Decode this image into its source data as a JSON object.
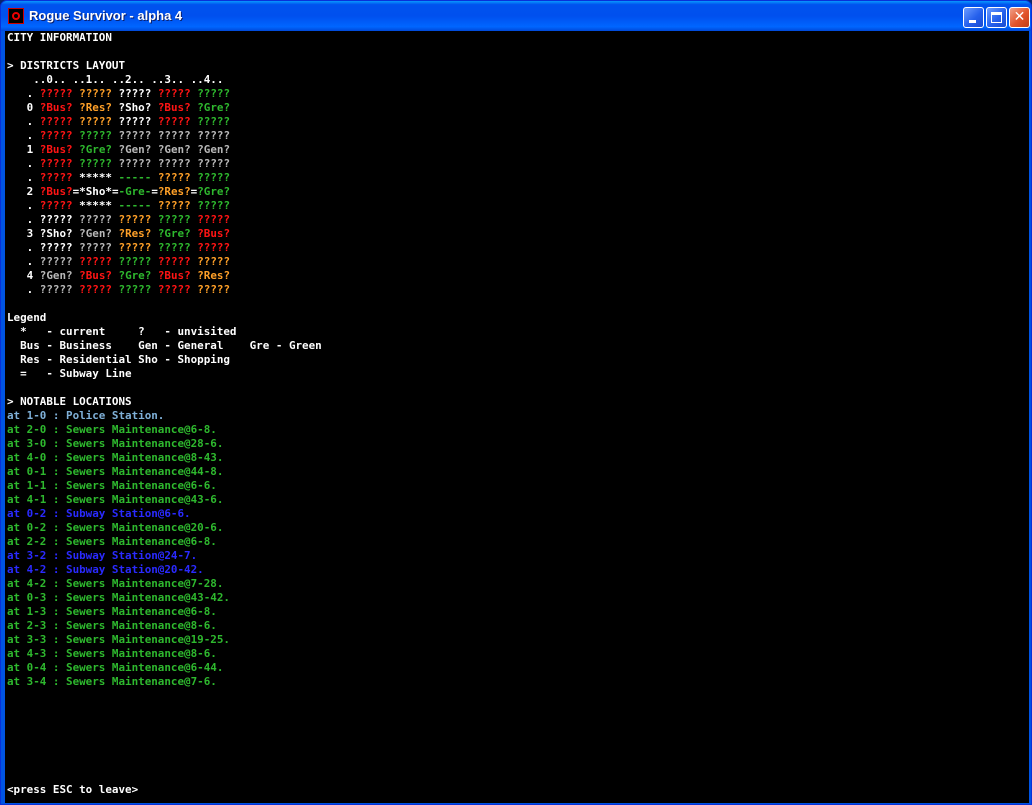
{
  "window": {
    "title": "Rogue Survivor - alpha 4",
    "icon": "rogue-survivor-app-icon"
  },
  "screen": {
    "header": "CITY INFORMATION",
    "districts_heading": "> DISTRICTS LAYOUT",
    "grid_header": "    ..0.. ..1.. ..2.. ..3.. ..4..",
    "colors": {
      "w": "#ffffff",
      "r": "#ff1414",
      "o": "#ffa028",
      "g": "#2eb82e",
      "s": "#b8b8b8",
      "b": "#2a2aff",
      "l": "#7fb0d8"
    },
    "grid_rows": [
      [
        [
          "   . ",
          "w"
        ],
        [
          "?????",
          "r"
        ],
        [
          " ",
          "w"
        ],
        [
          "?????",
          "o"
        ],
        [
          " ",
          "w"
        ],
        [
          "?????",
          "w"
        ],
        [
          " ",
          "w"
        ],
        [
          "?????",
          "r"
        ],
        [
          " ",
          "w"
        ],
        [
          "?????",
          "g"
        ]
      ],
      [
        [
          "   0 ",
          "w"
        ],
        [
          "?Bus?",
          "r"
        ],
        [
          " ",
          "w"
        ],
        [
          "?Res?",
          "o"
        ],
        [
          " ",
          "w"
        ],
        [
          "?Sho?",
          "w"
        ],
        [
          " ",
          "w"
        ],
        [
          "?Bus?",
          "r"
        ],
        [
          " ",
          "w"
        ],
        [
          "?Gre?",
          "g"
        ]
      ],
      [
        [
          "   . ",
          "w"
        ],
        [
          "?????",
          "r"
        ],
        [
          " ",
          "w"
        ],
        [
          "?????",
          "o"
        ],
        [
          " ",
          "w"
        ],
        [
          "?????",
          "w"
        ],
        [
          " ",
          "w"
        ],
        [
          "?????",
          "r"
        ],
        [
          " ",
          "w"
        ],
        [
          "?????",
          "g"
        ]
      ],
      [
        [
          "   . ",
          "w"
        ],
        [
          "?????",
          "r"
        ],
        [
          " ",
          "w"
        ],
        [
          "?????",
          "g"
        ],
        [
          " ",
          "w"
        ],
        [
          "?????",
          "s"
        ],
        [
          " ",
          "w"
        ],
        [
          "?????",
          "s"
        ],
        [
          " ",
          "w"
        ],
        [
          "?????",
          "s"
        ]
      ],
      [
        [
          "   1 ",
          "w"
        ],
        [
          "?Bus?",
          "r"
        ],
        [
          " ",
          "w"
        ],
        [
          "?Gre?",
          "g"
        ],
        [
          " ",
          "w"
        ],
        [
          "?Gen?",
          "s"
        ],
        [
          " ",
          "w"
        ],
        [
          "?Gen?",
          "s"
        ],
        [
          " ",
          "w"
        ],
        [
          "?Gen?",
          "s"
        ]
      ],
      [
        [
          "   . ",
          "w"
        ],
        [
          "?????",
          "r"
        ],
        [
          " ",
          "w"
        ],
        [
          "?????",
          "g"
        ],
        [
          " ",
          "w"
        ],
        [
          "?????",
          "s"
        ],
        [
          " ",
          "w"
        ],
        [
          "?????",
          "s"
        ],
        [
          " ",
          "w"
        ],
        [
          "?????",
          "s"
        ]
      ],
      [
        [
          "   . ",
          "w"
        ],
        [
          "?????",
          "r"
        ],
        [
          " ",
          "w"
        ],
        [
          "*****",
          "w"
        ],
        [
          " ",
          "w"
        ],
        [
          "-----",
          "g"
        ],
        [
          " ",
          "w"
        ],
        [
          "?????",
          "o"
        ],
        [
          " ",
          "w"
        ],
        [
          "?????",
          "g"
        ]
      ],
      [
        [
          "   2 ",
          "w"
        ],
        [
          "?Bus?",
          "r"
        ],
        [
          "=",
          "w"
        ],
        [
          "*Sho*",
          "w"
        ],
        [
          "=",
          "w"
        ],
        [
          "-Gre-",
          "g"
        ],
        [
          "=",
          "w"
        ],
        [
          "?Res?",
          "o"
        ],
        [
          "=",
          "w"
        ],
        [
          "?Gre?",
          "g"
        ]
      ],
      [
        [
          "   . ",
          "w"
        ],
        [
          "?????",
          "r"
        ],
        [
          " ",
          "w"
        ],
        [
          "*****",
          "w"
        ],
        [
          " ",
          "w"
        ],
        [
          "-----",
          "g"
        ],
        [
          " ",
          "w"
        ],
        [
          "?????",
          "o"
        ],
        [
          " ",
          "w"
        ],
        [
          "?????",
          "g"
        ]
      ],
      [
        [
          "   . ",
          "w"
        ],
        [
          "?????",
          "w"
        ],
        [
          " ",
          "w"
        ],
        [
          "?????",
          "s"
        ],
        [
          " ",
          "w"
        ],
        [
          "?????",
          "o"
        ],
        [
          " ",
          "w"
        ],
        [
          "?????",
          "g"
        ],
        [
          " ",
          "w"
        ],
        [
          "?????",
          "r"
        ]
      ],
      [
        [
          "   3 ",
          "w"
        ],
        [
          "?Sho?",
          "w"
        ],
        [
          " ",
          "w"
        ],
        [
          "?Gen?",
          "s"
        ],
        [
          " ",
          "w"
        ],
        [
          "?Res?",
          "o"
        ],
        [
          " ",
          "w"
        ],
        [
          "?Gre?",
          "g"
        ],
        [
          " ",
          "w"
        ],
        [
          "?Bus?",
          "r"
        ]
      ],
      [
        [
          "   . ",
          "w"
        ],
        [
          "?????",
          "w"
        ],
        [
          " ",
          "w"
        ],
        [
          "?????",
          "s"
        ],
        [
          " ",
          "w"
        ],
        [
          "?????",
          "o"
        ],
        [
          " ",
          "w"
        ],
        [
          "?????",
          "g"
        ],
        [
          " ",
          "w"
        ],
        [
          "?????",
          "r"
        ]
      ],
      [
        [
          "   . ",
          "w"
        ],
        [
          "?????",
          "s"
        ],
        [
          " ",
          "w"
        ],
        [
          "?????",
          "r"
        ],
        [
          " ",
          "w"
        ],
        [
          "?????",
          "g"
        ],
        [
          " ",
          "w"
        ],
        [
          "?????",
          "r"
        ],
        [
          " ",
          "w"
        ],
        [
          "?????",
          "o"
        ]
      ],
      [
        [
          "   4 ",
          "w"
        ],
        [
          "?Gen?",
          "s"
        ],
        [
          " ",
          "w"
        ],
        [
          "?Bus?",
          "r"
        ],
        [
          " ",
          "w"
        ],
        [
          "?Gre?",
          "g"
        ],
        [
          " ",
          "w"
        ],
        [
          "?Bus?",
          "r"
        ],
        [
          " ",
          "w"
        ],
        [
          "?Res?",
          "o"
        ]
      ],
      [
        [
          "   . ",
          "w"
        ],
        [
          "?????",
          "s"
        ],
        [
          " ",
          "w"
        ],
        [
          "?????",
          "r"
        ],
        [
          " ",
          "w"
        ],
        [
          "?????",
          "g"
        ],
        [
          " ",
          "w"
        ],
        [
          "?????",
          "r"
        ],
        [
          " ",
          "w"
        ],
        [
          "?????",
          "o"
        ]
      ]
    ],
    "legend_heading": "Legend",
    "legend_lines": [
      "  *   - current     ?   - unvisited",
      "  Bus - Business    Gen - General    Gre - Green",
      "  Res - Residential Sho - Shopping",
      "  =   - Subway Line"
    ],
    "notable_heading": "> NOTABLE LOCATIONS",
    "notable_locations": [
      [
        "at 1-0 : Police Station.",
        "l"
      ],
      [
        "at 2-0 : Sewers Maintenance@6-8.",
        "g"
      ],
      [
        "at 3-0 : Sewers Maintenance@28-6.",
        "g"
      ],
      [
        "at 4-0 : Sewers Maintenance@8-43.",
        "g"
      ],
      [
        "at 0-1 : Sewers Maintenance@44-8.",
        "g"
      ],
      [
        "at 1-1 : Sewers Maintenance@6-6.",
        "g"
      ],
      [
        "at 4-1 : Sewers Maintenance@43-6.",
        "g"
      ],
      [
        "at 0-2 : Subway Station@6-6.",
        "b"
      ],
      [
        "at 0-2 : Sewers Maintenance@20-6.",
        "g"
      ],
      [
        "at 2-2 : Sewers Maintenance@6-8.",
        "g"
      ],
      [
        "at 3-2 : Subway Station@24-7.",
        "b"
      ],
      [
        "at 4-2 : Subway Station@20-42.",
        "b"
      ],
      [
        "at 4-2 : Sewers Maintenance@7-28.",
        "g"
      ],
      [
        "at 0-3 : Sewers Maintenance@43-42.",
        "g"
      ],
      [
        "at 1-3 : Sewers Maintenance@6-8.",
        "g"
      ],
      [
        "at 2-3 : Sewers Maintenance@8-6.",
        "g"
      ],
      [
        "at 3-3 : Sewers Maintenance@19-25.",
        "g"
      ],
      [
        "at 4-3 : Sewers Maintenance@8-6.",
        "g"
      ],
      [
        "at 0-4 : Sewers Maintenance@6-44.",
        "g"
      ],
      [
        "at 3-4 : Sewers Maintenance@7-6.",
        "g"
      ]
    ],
    "footer": "<press ESC to leave>"
  }
}
